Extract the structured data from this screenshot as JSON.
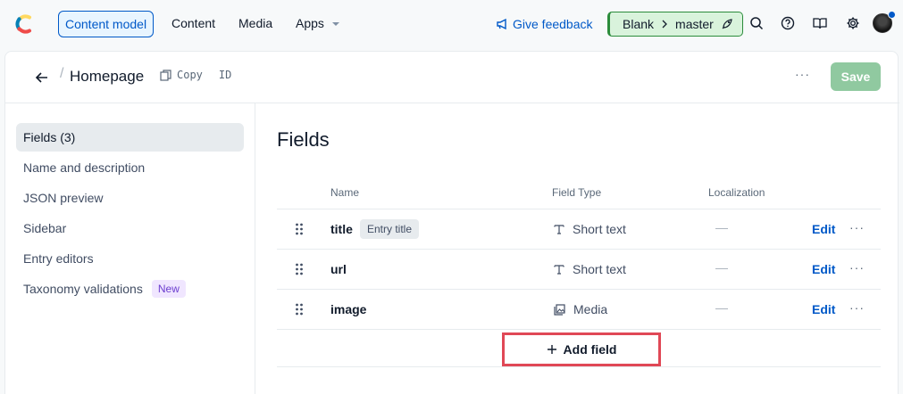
{
  "topnav": {
    "items": [
      {
        "label": "Content model",
        "active": true
      },
      {
        "label": "Content"
      },
      {
        "label": "Media"
      },
      {
        "label": "Apps"
      }
    ],
    "feedback_label": "Give feedback",
    "environment": {
      "space": "Blank",
      "branch": "master"
    },
    "icons": [
      "search-icon",
      "help-icon",
      "docs-icon",
      "settings-icon"
    ]
  },
  "header": {
    "title": "Homepage",
    "copy_label": "Copy",
    "id_label": "ID",
    "more": "···",
    "save_label": "Save"
  },
  "sidebar": {
    "items": [
      {
        "label": "Fields (3)",
        "active": true
      },
      {
        "label": "Name and description"
      },
      {
        "label": "JSON preview"
      },
      {
        "label": "Sidebar"
      },
      {
        "label": "Entry editors"
      },
      {
        "label": "Taxonomy validations",
        "badge": "New"
      }
    ]
  },
  "content": {
    "title": "Fields",
    "columns": [
      "Name",
      "Field Type",
      "Localization"
    ],
    "rows": [
      {
        "name": "title",
        "badge": "Entry title",
        "type": "Short text",
        "type_icon": "text-icon",
        "localization": "—",
        "edit": "Edit",
        "more": "···"
      },
      {
        "name": "url",
        "type": "Short text",
        "type_icon": "text-icon",
        "localization": "—",
        "edit": "Edit",
        "more": "···"
      },
      {
        "name": "image",
        "type": "Media",
        "type_icon": "media-icon",
        "localization": "—",
        "edit": "Edit",
        "more": "···"
      }
    ],
    "add_field_label": "Add field"
  },
  "colors": {
    "accent": "#0059c8",
    "save_disabled": "#90c9a0",
    "env_green": "#d9f3dc",
    "highlight": "#e04856"
  }
}
